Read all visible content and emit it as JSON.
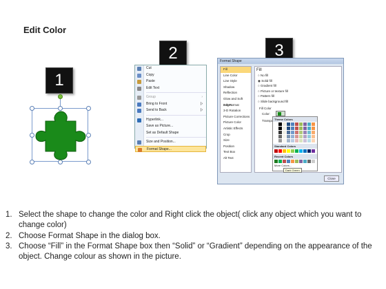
{
  "title": "Edit Color",
  "steps": [
    "1",
    "2",
    "3"
  ],
  "context_menu": {
    "items": [
      {
        "label": "Cut",
        "icon": "scissors-icon",
        "color": "#5b7fb3"
      },
      {
        "label": "Copy",
        "icon": "copy-icon",
        "color": "#6b8fc7"
      },
      {
        "label": "Paste",
        "icon": "paste-icon",
        "color": "#c89b3c"
      },
      {
        "label": "Edit Text",
        "icon": "edit-text-icon",
        "color": "#888"
      },
      {
        "label": "Group",
        "icon": "group-icon",
        "color": "#999",
        "arrow": "›",
        "disabled": true
      },
      {
        "label": "Bring to Front",
        "icon": "bring-front-icon",
        "color": "#4a7abf",
        "arrow": "|›"
      },
      {
        "label": "Send to Back",
        "icon": "send-back-icon",
        "color": "#4a7abf",
        "arrow": "|›"
      },
      {
        "label": "Hyperlink...",
        "icon": "hyperlink-icon",
        "color": "#2f6db5"
      },
      {
        "label": "Save as Picture...",
        "icon": "",
        "color": ""
      },
      {
        "label": "Set as Default Shape",
        "icon": "",
        "color": ""
      },
      {
        "label": "Size and Position...",
        "icon": "size-icon",
        "color": "#5b7fb3"
      },
      {
        "label": "Format Shape...",
        "icon": "format-shape-icon",
        "color": "#d97a2b",
        "highlight": true
      }
    ]
  },
  "dialog": {
    "title": "Format Shape",
    "categories": [
      "Fill",
      "Line Color",
      "Line Style",
      "Shadow",
      "Reflection",
      "Glow and Soft Edges",
      "3-D Format",
      "3-D Rotation",
      "Picture Corrections",
      "Picture Color",
      "Artistic Effects",
      "Crop",
      "Size",
      "Position",
      "Text Box",
      "Alt Text"
    ],
    "fill_heading": "Fill",
    "options": [
      "No fill",
      "Solid fill",
      "Gradient fill",
      "Picture or texture fill",
      "Pattern fill",
      "Slide background fill"
    ],
    "fill_color_label": "Fill Color",
    "color_label": "Color:",
    "transparency_label": "Transpar",
    "close_label": "Close"
  },
  "palette": {
    "theme_label": "Theme Colors",
    "standard_label": "Standard Colors",
    "recent_label": "Recent Colors",
    "more_label": "More Colors...",
    "tooltip": "Dark Green",
    "theme_row": [
      "#ffffff",
      "#000000",
      "#eeece1",
      "#1f497d",
      "#4f81bd",
      "#c0504d",
      "#9bbb59",
      "#8064a2",
      "#4bacc6",
      "#f79646"
    ],
    "standard_row": [
      "#c00000",
      "#ff0000",
      "#ffc000",
      "#ffff00",
      "#92d050",
      "#00b050",
      "#00b0f0",
      "#0070c0",
      "#002060",
      "#7030a0"
    ],
    "recent_row": [
      "#1f7a1f",
      "#00b050",
      "#c0504d",
      "#4f81bd",
      "#f79646",
      "#9bbb59",
      "#8064a2",
      "#4bacc6",
      "#666666",
      "#cccccc"
    ]
  },
  "puzzle_color": "#1a8a1a",
  "instructions": [
    {
      "num": "1.",
      "text": "Select the shape to change the color and Right click the object( click any object which you want to change color)"
    },
    {
      "num": "2.",
      "text": "Choose Format Shape in the dialog box."
    },
    {
      "num": "3.",
      "text": "Choose “Fill” in the Format Shape box then “Solid” or “Gradient” depending on the appearance of the object. Change colour as shown in the picture."
    }
  ]
}
